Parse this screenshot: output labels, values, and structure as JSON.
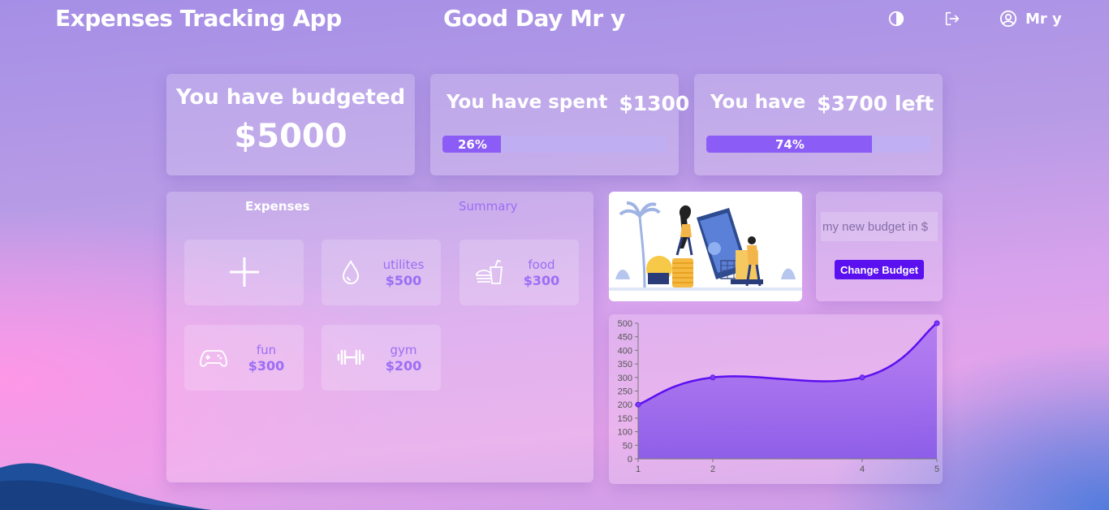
{
  "header": {
    "app_title": "Expenses Tracking App",
    "greeting": "Good Day Mr y",
    "user_name": "Mr y"
  },
  "summary": {
    "budget_label": "You have budgeted",
    "budget_amount": "$5000",
    "spent_label": "You have spent",
    "spent_amount": "$1300",
    "spent_percent_label": "26%",
    "spent_fraction": 0.26,
    "left_label_prefix": "You have",
    "left_amount": "$3700 left",
    "left_percent_label": "74%",
    "left_fraction": 0.74
  },
  "tabs": {
    "expenses": "Expenses",
    "summary": "Summary"
  },
  "categories": [
    {
      "name": "utilites",
      "amount": "$500",
      "icon": "water-drop-icon"
    },
    {
      "name": "food",
      "amount": "$300",
      "icon": "fast-food-icon"
    },
    {
      "name": "fun",
      "amount": "$300",
      "icon": "gamepad-icon"
    },
    {
      "name": "gym",
      "amount": "$200",
      "icon": "dumbbell-icon"
    }
  ],
  "new_budget": {
    "placeholder": "my new budget in $",
    "button_label": "Change Budget"
  },
  "colors": {
    "accent": "#5b10f0",
    "progress_fill": "#8b5cf6",
    "category_text": "#9b6ef5"
  },
  "chart_data": {
    "type": "area",
    "x": [
      1,
      2,
      4,
      5
    ],
    "values": [
      200,
      300,
      300,
      500
    ],
    "ylim": [
      0,
      500
    ],
    "yticks": [
      0,
      50,
      100,
      150,
      200,
      250,
      300,
      350,
      400,
      450,
      500
    ],
    "xticks": [
      "1",
      "2",
      "4",
      "5"
    ],
    "grid": false,
    "title": "",
    "xlabel": "",
    "ylabel": ""
  }
}
